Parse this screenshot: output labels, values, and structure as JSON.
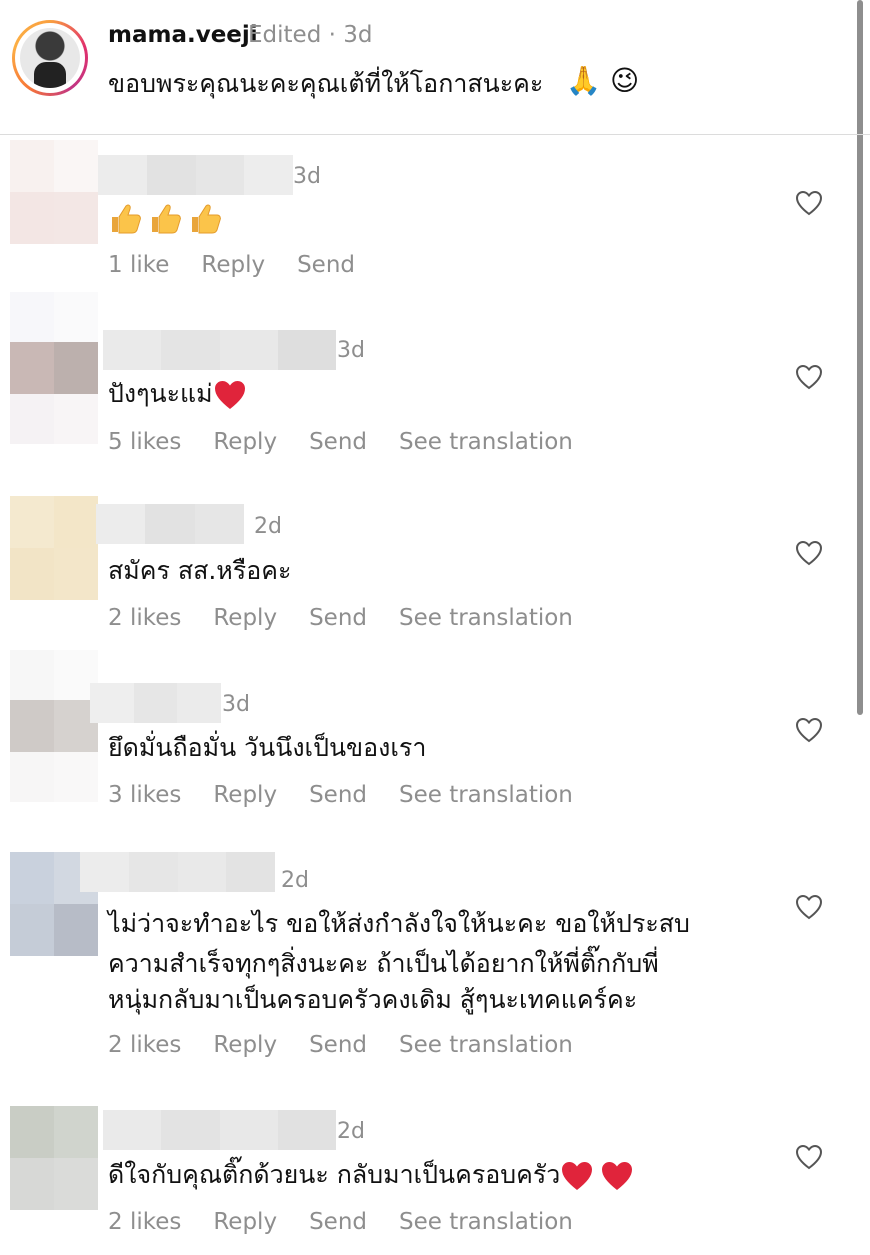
{
  "original_post": {
    "username": "mama.veeji",
    "meta": "Edited · 3d",
    "text": "ขอบพระคุณนะคะคุณเต้ที่ให้โอกาสนะคะ",
    "emojis": [
      "🙏",
      "😉"
    ]
  },
  "comments": [
    {
      "time": "3d",
      "text": "",
      "emoji": [
        "thumbs-up",
        "thumbs-up",
        "thumbs-up"
      ],
      "likes": "1 like",
      "reply": "Reply",
      "send": "Send",
      "translate": ""
    },
    {
      "time": "3d",
      "text": "ปังๆนะแม่",
      "likes": "5 likes",
      "reply": "Reply",
      "send": "Send",
      "translate": "See translation"
    },
    {
      "time": "2d",
      "text": "สมัคร สส.หรือคะ",
      "likes": "2 likes",
      "reply": "Reply",
      "send": "Send",
      "translate": "See translation"
    },
    {
      "time": "3d",
      "text": "ยึดมั่นถือมั่น วันนึงเป็นของเรา",
      "likes": "3 likes",
      "reply": "Reply",
      "send": "Send",
      "translate": "See translation"
    },
    {
      "time": "2d",
      "text_lines": [
        "ไม่ว่าจะทำอะไร ขอให้ส่งกำลังใจให้นะคะ ขอให้ประสบ",
        "ความสำเร็จทุกๆสิ่งนะคะ ถ้าเป็นได้อยากให้พี่ติ๊กกับพี่",
        "หนุ่มกลับมาเป็นครอบครัวคงเดิม สู้ๆนะเทคแคร์คะ"
      ],
      "likes": "2 likes",
      "reply": "Reply",
      "send": "Send",
      "translate": "See translation"
    },
    {
      "time": "2d",
      "text": "ดีใจกับคุณติ๊กด้วยนะ กลับมาเป็นครอบครัว",
      "likes": "2 likes",
      "reply": "Reply",
      "send": "Send",
      "translate": "See translation"
    }
  ],
  "colors": {
    "meta_gray": "#8e8e8e",
    "heart_red": "#e0243b",
    "divider": "#dcdcdc"
  }
}
